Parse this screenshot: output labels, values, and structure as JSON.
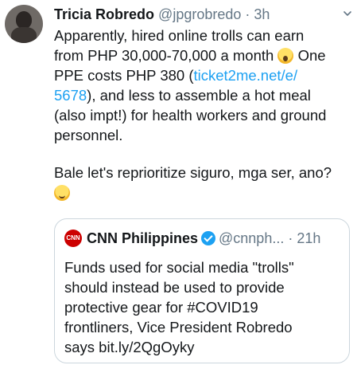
{
  "tweet": {
    "display_name": "Tricia Robredo",
    "handle": "@jpgrobredo",
    "separator": "·",
    "time": "3h",
    "lines": [
      {
        "text": "Apparently, hired online trolls can earn"
      },
      {
        "text_before": "from PHP 30,000-70,000 a month ",
        "emoji": "scream-emoji",
        "text_after": " One"
      },
      {
        "text_before": "PPE costs PHP 380 (",
        "link": "ticket2me.net/e/"
      },
      {
        "link": "5678",
        "text_after": "), and less to assemble a hot meal"
      },
      {
        "text": "(also impt!) for health workers and ground"
      },
      {
        "text": "personnel."
      },
      {
        "text": "Bale let's reprioritize siguro, mga ser, ano?"
      }
    ],
    "final_emoji": "wink-emoji"
  },
  "quoted": {
    "logo_text": "CNN",
    "display_name": "CNN Philippines",
    "handle": "@cnnph...",
    "separator": "·",
    "time": "21h",
    "lines": [
      "Funds used for social media \"trolls\"",
      "should instead be used to provide",
      "protective gear for #COVID19",
      "frontliners, Vice President Robredo",
      "says bit.ly/2QgOyky"
    ]
  },
  "colors": {
    "link": "#1da1f2",
    "meta": "#657786",
    "text": "#14171a",
    "border": "#ccd6dd",
    "cnn_red": "#cc0000"
  }
}
